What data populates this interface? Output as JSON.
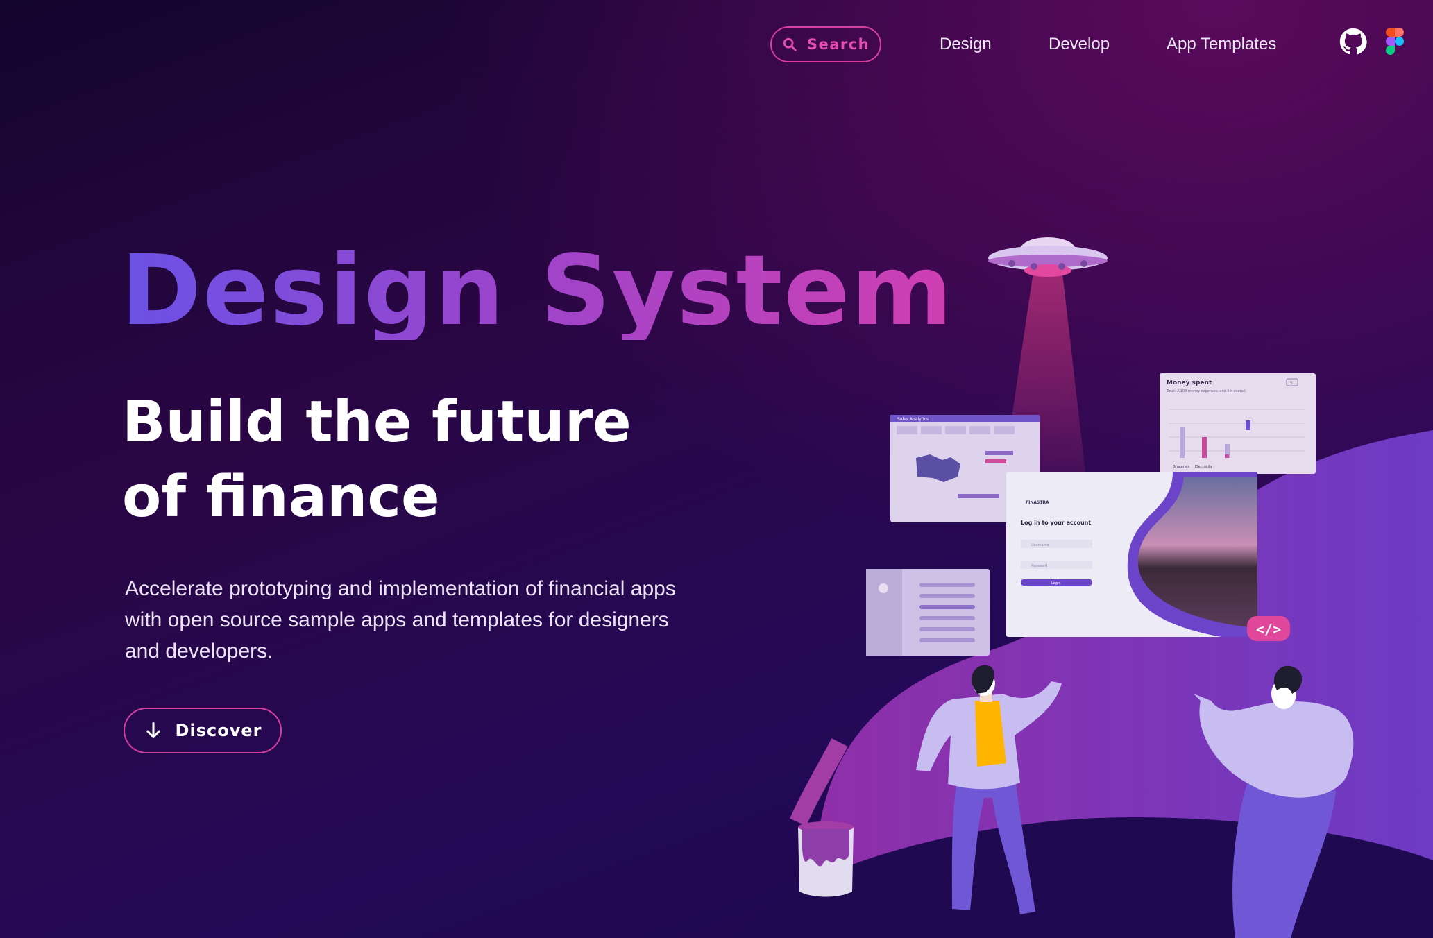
{
  "nav": {
    "search_label": "Search",
    "links": [
      "Design",
      "Develop",
      "App Templates"
    ],
    "icons": [
      "github-icon",
      "figma-icon"
    ]
  },
  "hero": {
    "title": "Design System",
    "subtitle_line1": "Build the future",
    "subtitle_line2": "of finance",
    "description_line1": "Accelerate prototyping and implementation of financial apps",
    "description_line2": "with open source sample apps and templates for designers",
    "description_line3": "and developers.",
    "cta_label": "Discover"
  },
  "illustration": {
    "money_card_title": "Money spent",
    "money_card_subtitle": "Total: 2,108 money expenses, and 5 k overall.",
    "money_card_x_labels": [
      "Groceries",
      "Electricity"
    ],
    "money_card_badge": "5",
    "analytics_card_title": "Sales Analytics",
    "login_brand": "FINASTRA",
    "login_heading": "Log in to your account",
    "login_username_placeholder": "Username",
    "login_password_placeholder": "Password",
    "login_button": "Login",
    "code_badge": "</>"
  },
  "colors": {
    "accent_pink": "#d63ea0",
    "title_gradient_start": "#6a52e6",
    "title_gradient_end": "#cf3fb2",
    "background": "#1e0748"
  }
}
